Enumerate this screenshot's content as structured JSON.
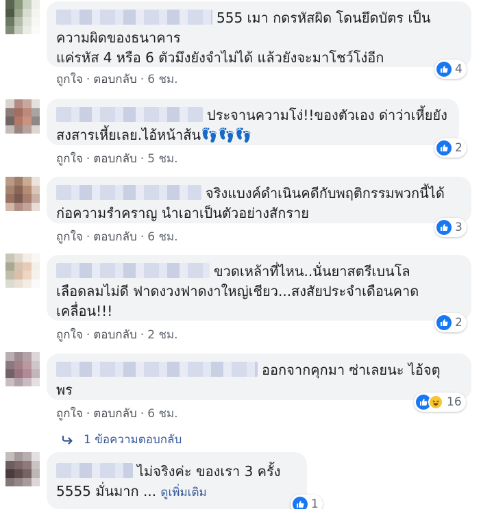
{
  "comments": [
    {
      "text_lines": [
        "555 เมา กดรหัสผิด โดนยึดบัตร เป็น",
        "ความผิดของธนาคาร",
        "แค่รหัส 4 หรือ 6 ตัวมึงยังจำไม่ได้ แล้วยังจะมาโชว์โง่อีก"
      ],
      "reactions": [
        "like"
      ],
      "reaction_count": "4",
      "like_label": "ถูกใจ",
      "reply_label": "ตอบกลับ",
      "time": "6 ชม."
    },
    {
      "text_lines": [
        "ประจานความโง่!!ของตัวเอง ด่าว่าเหี้ยยัง",
        "สงสารเหี้ยเลย.ไอ้หน้าส้น👣👣👣"
      ],
      "reactions": [
        "like"
      ],
      "reaction_count": "2",
      "like_label": "ถูกใจ",
      "reply_label": "ตอบกลับ",
      "time": "5 ชม."
    },
    {
      "text_lines": [
        "จริงแบงค์ดำเนินคดีกับพฤติกรรมพวกนี้ได้",
        "ก่อความรำคราญ นำเอาเป็นตัวอย่างสักราย"
      ],
      "reactions": [
        "like"
      ],
      "reaction_count": "3",
      "like_label": "ถูกใจ",
      "reply_label": "ตอบกลับ",
      "time": "6 ชม."
    },
    {
      "text_lines": [
        "ขวดเหล้าที่ไหน..นั่นยาสตรีเบนโล",
        "เลือดลมไม่ดี ฟาดงวงฟาดงาใหญ่เชียว...สงสัยประจำเดือนคาด",
        "เคลื่อน!!!"
      ],
      "reactions": [
        "like"
      ],
      "reaction_count": "2",
      "like_label": "ถูกใจ",
      "reply_label": "ตอบกลับ",
      "time": "2 ชม."
    },
    {
      "text_lines": [
        "ออกจากคุกมา ซ่าเลยนะ ไอ้จตุ",
        "พร"
      ],
      "reactions": [
        "like",
        "haha"
      ],
      "reaction_count": "16",
      "like_label": "ถูกใจ",
      "reply_label": "ตอบกลับ",
      "time": "6 ชม."
    },
    {
      "text_lines": [
        "ไม่จริงค่ะ ของเรา 3 ครั้ง",
        "5555 มั่นมาก ... "
      ],
      "see_more": "ดูเพิ่มเติม",
      "reactions": [
        "like"
      ],
      "reaction_count": "1"
    }
  ],
  "reply_link": "1 ข้อความตอบกลับ",
  "colors": {
    "link": "#385898",
    "bubble": "#f2f3f5",
    "like": "#1877f2",
    "meta": "#606770"
  },
  "icons": {
    "like": "thumbs-up-icon",
    "haha": "laughing-face-icon",
    "reply": "reply-arrow-icon"
  }
}
